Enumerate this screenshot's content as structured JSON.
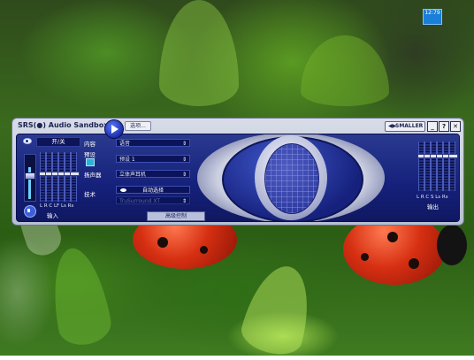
{
  "clock": {
    "line1": "12:79",
    "line2": ""
  },
  "window": {
    "title": "SRS(●) Audio Sandbox",
    "options_label": "选项...",
    "smaller_label": "SMALLER",
    "minimize_label": "_",
    "help_label": "?",
    "close_label": "✕"
  },
  "mixer": {
    "power_label": "开/关",
    "channel_labels": "L R C LF Ls Rs",
    "input_label": "输入"
  },
  "settings": {
    "content_label": "内容",
    "content_value": "语音",
    "preset_label": "预设",
    "preset_value": "预设 1",
    "speakers_label": "扬声器",
    "speakers_value": "立体声耳机",
    "tech_label": "技术",
    "auto_select_label": "自动选择",
    "tech_value": "TruSurround XT",
    "advanced_label": "高级控制"
  },
  "output": {
    "channel_labels": "L R C S Ls Rs",
    "output_label": "输出"
  },
  "icons": {
    "play": "play-icon",
    "power": "eye-icon",
    "speaker": "speaker-icon",
    "preset": "preset-icon",
    "smaller": "arrow-icon"
  }
}
